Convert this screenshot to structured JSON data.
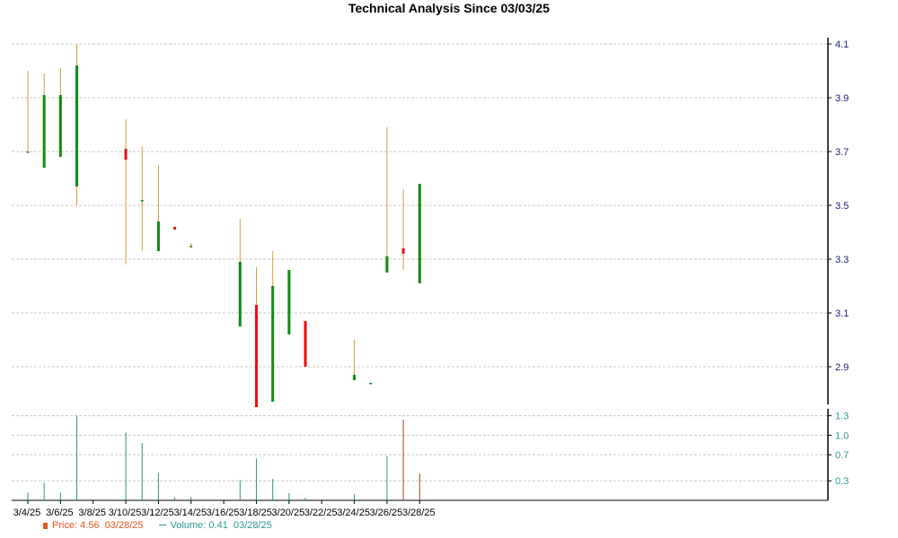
{
  "chart_data": {
    "type": "candlestick",
    "title": "Technical Analysis Since 03/03/25",
    "x_tick_labels": [
      "3/4/25",
      "3/6/25",
      "3/8/25",
      "3/10/25",
      "3/12/25",
      "3/14/25",
      "3/16/25",
      "3/18/25",
      "3/20/25",
      "3/22/25",
      "3/24/25",
      "3/26/25",
      "3/28/25"
    ],
    "price_axis": {
      "ylim": [
        2.76,
        4.1
      ],
      "ticks": [
        "2.9",
        "3.1",
        "3.3",
        "3.5",
        "3.7",
        "3.9",
        "4.1"
      ],
      "tick_values": [
        2.9,
        3.1,
        3.3,
        3.5,
        3.7,
        3.9,
        4.1
      ]
    },
    "volume_axis": {
      "ylim": [
        0,
        1.35
      ],
      "ticks": [
        "0.3",
        "0.7",
        "1.0",
        "1.3"
      ],
      "tick_values": [
        0.3,
        0.7,
        1.0,
        1.3
      ]
    },
    "candles": [
      {
        "date": "3/4/25",
        "open": 3.7,
        "high": 4.0,
        "low": 3.7,
        "close": 3.7
      },
      {
        "date": "3/5/25",
        "open": 3.64,
        "high": 3.99,
        "low": 3.64,
        "close": 3.91
      },
      {
        "date": "3/6/25",
        "open": 3.68,
        "high": 4.01,
        "low": 3.68,
        "close": 3.91
      },
      {
        "date": "3/7/25",
        "open": 3.57,
        "high": 4.1,
        "low": 3.5,
        "close": 4.02
      },
      {
        "date": "3/10/25",
        "open": 3.71,
        "high": 3.82,
        "low": 3.28,
        "close": 3.67
      },
      {
        "date": "3/11/25",
        "open": 3.52,
        "high": 3.72,
        "low": 3.33,
        "close": 3.52
      },
      {
        "date": "3/12/25",
        "open": 3.33,
        "high": 3.65,
        "low": 3.33,
        "close": 3.44
      },
      {
        "date": "3/13/25",
        "open": 3.42,
        "high": 3.42,
        "low": 3.41,
        "close": 3.41
      },
      {
        "date": "3/14/25",
        "open": 3.35,
        "high": 3.36,
        "low": 3.34,
        "close": 3.35
      },
      {
        "date": "3/17/25",
        "open": 3.05,
        "high": 3.45,
        "low": 3.05,
        "close": 3.29
      },
      {
        "date": "3/18/25",
        "open": 3.13,
        "high": 3.27,
        "low": 2.75,
        "close": 2.75
      },
      {
        "date": "3/19/25",
        "open": 2.77,
        "high": 3.33,
        "low": 2.77,
        "close": 3.2
      },
      {
        "date": "3/20/25",
        "open": 3.02,
        "high": 3.26,
        "low": 3.02,
        "close": 3.26
      },
      {
        "date": "3/21/25",
        "open": 3.07,
        "high": 3.07,
        "low": 2.9,
        "close": 2.9
      },
      {
        "date": "3/24/25",
        "open": 2.85,
        "high": 3.0,
        "low": 2.85,
        "close": 2.87
      },
      {
        "date": "3/25/25",
        "open": 2.84,
        "high": 2.84,
        "low": 2.84,
        "close": 2.84
      },
      {
        "date": "3/26/25",
        "open": 3.25,
        "high": 3.79,
        "low": 3.25,
        "close": 3.31
      },
      {
        "date": "3/27/25",
        "open": 3.34,
        "high": 3.56,
        "low": 3.26,
        "close": 3.32
      },
      {
        "date": "3/28/25",
        "open": 3.21,
        "high": 3.58,
        "low": 3.21,
        "close": 3.58
      }
    ],
    "volumes": [
      {
        "date": "3/4/25",
        "value": 0.12,
        "color": "green"
      },
      {
        "date": "3/5/25",
        "value": 0.27,
        "color": "green"
      },
      {
        "date": "3/6/25",
        "value": 0.12,
        "color": "green"
      },
      {
        "date": "3/7/25",
        "value": 1.3,
        "color": "green"
      },
      {
        "date": "3/10/25",
        "value": 1.04,
        "color": "green"
      },
      {
        "date": "3/11/25",
        "value": 0.88,
        "color": "green"
      },
      {
        "date": "3/12/25",
        "value": 0.42,
        "color": "green"
      },
      {
        "date": "3/13/25",
        "value": 0.05,
        "color": "green"
      },
      {
        "date": "3/14/25",
        "value": 0.05,
        "color": "green"
      },
      {
        "date": "3/17/25",
        "value": 0.31,
        "color": "green"
      },
      {
        "date": "3/18/25",
        "value": 0.64,
        "color": "green"
      },
      {
        "date": "3/19/25",
        "value": 0.33,
        "color": "green"
      },
      {
        "date": "3/20/25",
        "value": 0.11,
        "color": "green"
      },
      {
        "date": "3/21/25",
        "value": 0.04,
        "color": "green"
      },
      {
        "date": "3/24/25",
        "value": 0.1,
        "color": "green"
      },
      {
        "date": "3/26/25",
        "value": 0.68,
        "color": "green"
      },
      {
        "date": "3/27/25",
        "value": 1.24,
        "color": "red"
      },
      {
        "date": "3/28/25",
        "value": 0.41,
        "color": "red"
      }
    ],
    "colors": {
      "up": "#128a12",
      "down": "#e81010",
      "wick": "#d99a3c",
      "volume_green": "#2a9a6a",
      "volume_red": "#b83a2a",
      "grid": "#c8c8c8",
      "price_axis_text": "#1a1a7a",
      "volume_axis_text": "#2a9a94"
    },
    "legend": {
      "price_label": "Price: 4.56",
      "price_date": "03/28/25",
      "volume_label": "Volume: 0.41",
      "volume_date": "03/28/25"
    },
    "grid": true
  }
}
